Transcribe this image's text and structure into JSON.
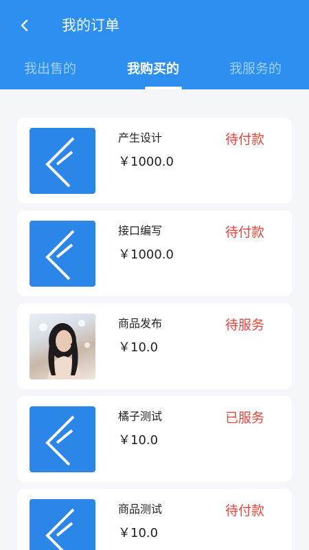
{
  "header": {
    "title": "我的订单",
    "tabs": [
      {
        "label": "我出售的",
        "active": false
      },
      {
        "label": "我购买的",
        "active": true
      },
      {
        "label": "我服务的",
        "active": false
      }
    ],
    "accent_color": "#2d8ff0"
  },
  "orders": [
    {
      "name": "产生设计",
      "price": "￥1000.0",
      "status": "待付款",
      "thumbnail": "app-logo-icon"
    },
    {
      "name": "接口编写",
      "price": "￥1000.0",
      "status": "待付款",
      "thumbnail": "app-logo-icon"
    },
    {
      "name": "商品发布",
      "price": "￥10.0",
      "status": "待服务",
      "thumbnail": "user-photo"
    },
    {
      "name": "橘子测试",
      "price": "￥10.0",
      "status": "已服务",
      "thumbnail": "app-logo-icon"
    },
    {
      "name": "商品测试",
      "price": "￥10.0",
      "status": "待付款",
      "thumbnail": "app-logo-icon"
    }
  ],
  "status_color": "#e5473c"
}
